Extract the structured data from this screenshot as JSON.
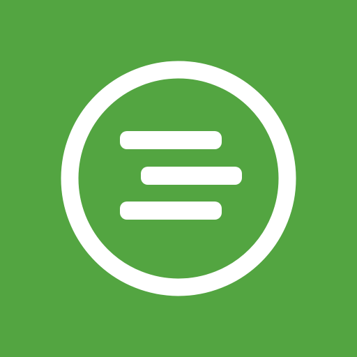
{
  "icon": {
    "name": "green-circle-three-bars-logo",
    "background_color": "#53a541",
    "foreground_color": "#ffffff"
  }
}
